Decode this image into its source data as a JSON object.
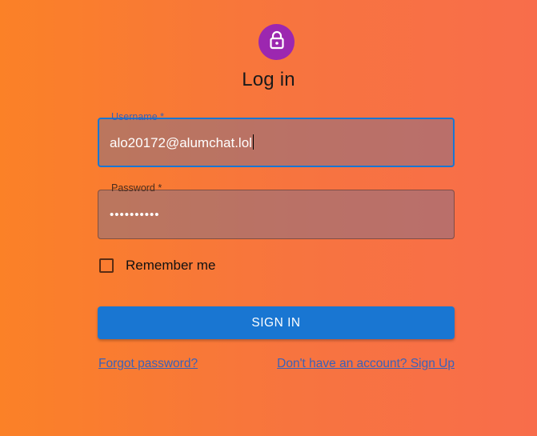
{
  "page": {
    "title": "Log in"
  },
  "icons": {
    "avatar": "lock-icon"
  },
  "colors": {
    "avatar_bg": "#9C27B0",
    "primary": "#1976D2",
    "background_start": "#FB8127",
    "background_end": "#F86D4B"
  },
  "form": {
    "username": {
      "label": "Username *",
      "value": "alo20172@alumchat.lol"
    },
    "password": {
      "label": "Password *",
      "value": "••••••••••"
    },
    "remember": {
      "label": "Remember me",
      "checked": false
    },
    "submit_label": "SIGN IN"
  },
  "links": {
    "forgot": "Forgot password?",
    "signup": "Don't have an account? Sign Up"
  }
}
